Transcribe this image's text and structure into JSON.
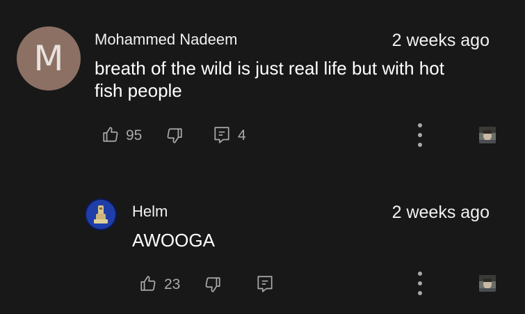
{
  "comment": {
    "avatar_letter": "M",
    "author": "Mohammed Nadeem",
    "time": "2 weeks ago",
    "text_line1": "breath of the wild is just real life but with hot",
    "text_line2": "fish people",
    "likes": "95",
    "replies": "4",
    "icons": [
      "like-icon",
      "dislike-icon",
      "reply-icon",
      "more-icon"
    ]
  },
  "reply": {
    "author": "Helm",
    "time": "2 weeks ago",
    "text": "AWOOGA",
    "likes": "23",
    "icons": [
      "like-icon",
      "dislike-icon",
      "reply-icon",
      "more-icon"
    ]
  },
  "colors": {
    "background": "#181818",
    "text_primary": "#f1f1f1",
    "text_secondary": "#aaaaaa",
    "avatar_m_bg": "#8c7064",
    "avatar_helm_bg": "#1f3ea8"
  }
}
